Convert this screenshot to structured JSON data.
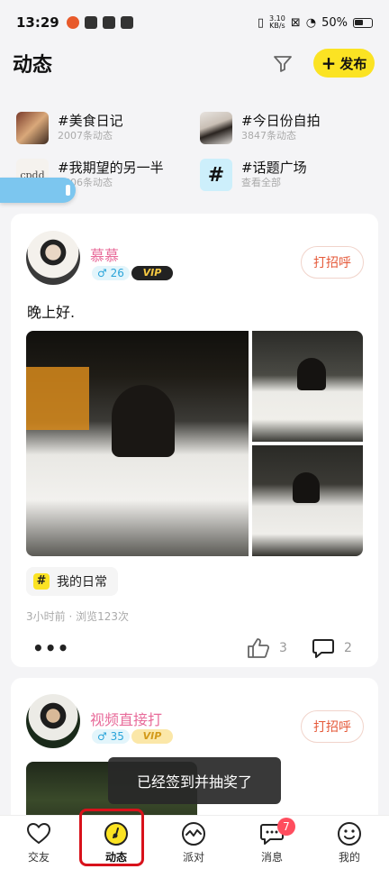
{
  "status_bar": {
    "time": "13:29",
    "speed_value": "3.10",
    "speed_unit": "KB/s",
    "battery": "50%"
  },
  "header": {
    "title": "动态",
    "publish_label": "发布",
    "publish_icon": "+"
  },
  "topics": [
    {
      "title": "#美食日记",
      "subtitle": "2007条动态",
      "thumb": "food-photo"
    },
    {
      "title": "#今日份自拍",
      "subtitle": "3847条动态",
      "thumb": "selfie-photo"
    },
    {
      "title": "#我期望的另一半",
      "subtitle": "6606条动态",
      "thumb": "wish-photo",
      "thumb_text": "cpdd"
    },
    {
      "title": "#话题广场",
      "subtitle": "查看全部",
      "thumb": "hash-icon",
      "thumb_text": "#"
    }
  ],
  "posts": [
    {
      "user_name": "慕慕",
      "gender_symbol": "♂",
      "age": "26",
      "vip_label": "VIP",
      "greet_label": "打招呼",
      "text": "晚上好.",
      "tag": "我的日常",
      "tag_icon": "#",
      "time_views": "3小时前 · 浏览123次",
      "likes": "3",
      "comments": "2",
      "more": "•••"
    },
    {
      "user_name": "视频直接打",
      "gender_symbol": "♂",
      "age": "35",
      "vip_label": "VIP",
      "greet_label": "打招呼"
    }
  ],
  "toast": "已经签到并抽奖了",
  "nav": {
    "items": [
      {
        "label": "交友",
        "icon": "heart-icon"
      },
      {
        "label": "动态",
        "icon": "compass-icon",
        "active": true
      },
      {
        "label": "派对",
        "icon": "wave-icon"
      },
      {
        "label": "消息",
        "icon": "chat-icon",
        "badge": "7"
      },
      {
        "label": "我的",
        "icon": "smile-icon"
      }
    ]
  },
  "colors": {
    "accent_yellow": "#fbe323",
    "name_pink": "#e86b9a",
    "greet_red": "#e55a3a",
    "highlight_red": "#d8121b"
  }
}
